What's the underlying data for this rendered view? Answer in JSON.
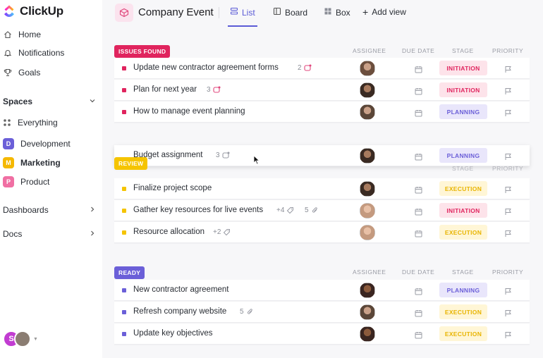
{
  "app": {
    "name": "ClickUp"
  },
  "sidebar": {
    "nav": [
      {
        "label": "Home",
        "icon": "home-icon"
      },
      {
        "label": "Notifications",
        "icon": "bell-icon"
      },
      {
        "label": "Goals",
        "icon": "trophy-icon"
      }
    ],
    "spaces_label": "Spaces",
    "everything_label": "Everything",
    "spaces": [
      {
        "letter": "D",
        "label": "Development",
        "color": "#6b5fd8"
      },
      {
        "letter": "M",
        "label": "Marketing",
        "color": "#f5b800"
      },
      {
        "letter": "P",
        "label": "Product",
        "color": "#f06fa3"
      }
    ],
    "dashboards_label": "Dashboards",
    "docs_label": "Docs",
    "user_initial": "S"
  },
  "header": {
    "title": "Company Event",
    "views": [
      {
        "label": "List",
        "icon": "list-icon"
      },
      {
        "label": "Board",
        "icon": "board-icon"
      },
      {
        "label": "Box",
        "icon": "box-icon"
      }
    ],
    "add_view_label": "Add view"
  },
  "columns": {
    "assignee": "ASSIGNEE",
    "due_date": "DUE DATE",
    "stage": "STAGE",
    "priority": "PRIORITY"
  },
  "groups": [
    {
      "label": "ISSUES FOUND",
      "color": "#e0245e",
      "tasks": [
        {
          "name": "Update new contractor agreement forms",
          "extra": "2",
          "extra_icon": "subtask-icon",
          "stage": "INITIATION",
          "stage_class": "initiation"
        },
        {
          "name": "Plan for next year",
          "extra": "3",
          "extra_icon": "subtask-icon",
          "stage": "INITIATION",
          "stage_class": "initiation"
        },
        {
          "name": "How to manage event planning",
          "extra": "",
          "stage": "PLANNING",
          "stage_class": "planning"
        }
      ]
    },
    {
      "label": "REVIEW",
      "color": "#f5c400",
      "dragging": {
        "name": "Budget assignment",
        "extra": "3",
        "stage": "PLANNING"
      },
      "tasks": [
        {
          "name": "Finalize project scope",
          "extra": "",
          "stage": "EXECUTION",
          "stage_class": "execution"
        },
        {
          "name": "Gather key resources for live events",
          "extra": "+4",
          "extra2": "5",
          "stage": "INITIATION",
          "stage_class": "initiation"
        },
        {
          "name": "Resource allocation",
          "extra": "+2",
          "stage": "EXECUTION",
          "stage_class": "execution"
        }
      ]
    },
    {
      "label": "READY",
      "color": "#6b5fd8",
      "tasks": [
        {
          "name": "New contractor agreement",
          "extra": "",
          "stage": "PLANNING",
          "stage_class": "planning"
        },
        {
          "name": "Refresh company website",
          "extra": "5",
          "stage": "EXECUTION",
          "stage_class": "execution"
        },
        {
          "name": "Update key objectives",
          "extra": "",
          "stage": "EXECUTION",
          "stage_class": "execution"
        }
      ]
    }
  ]
}
